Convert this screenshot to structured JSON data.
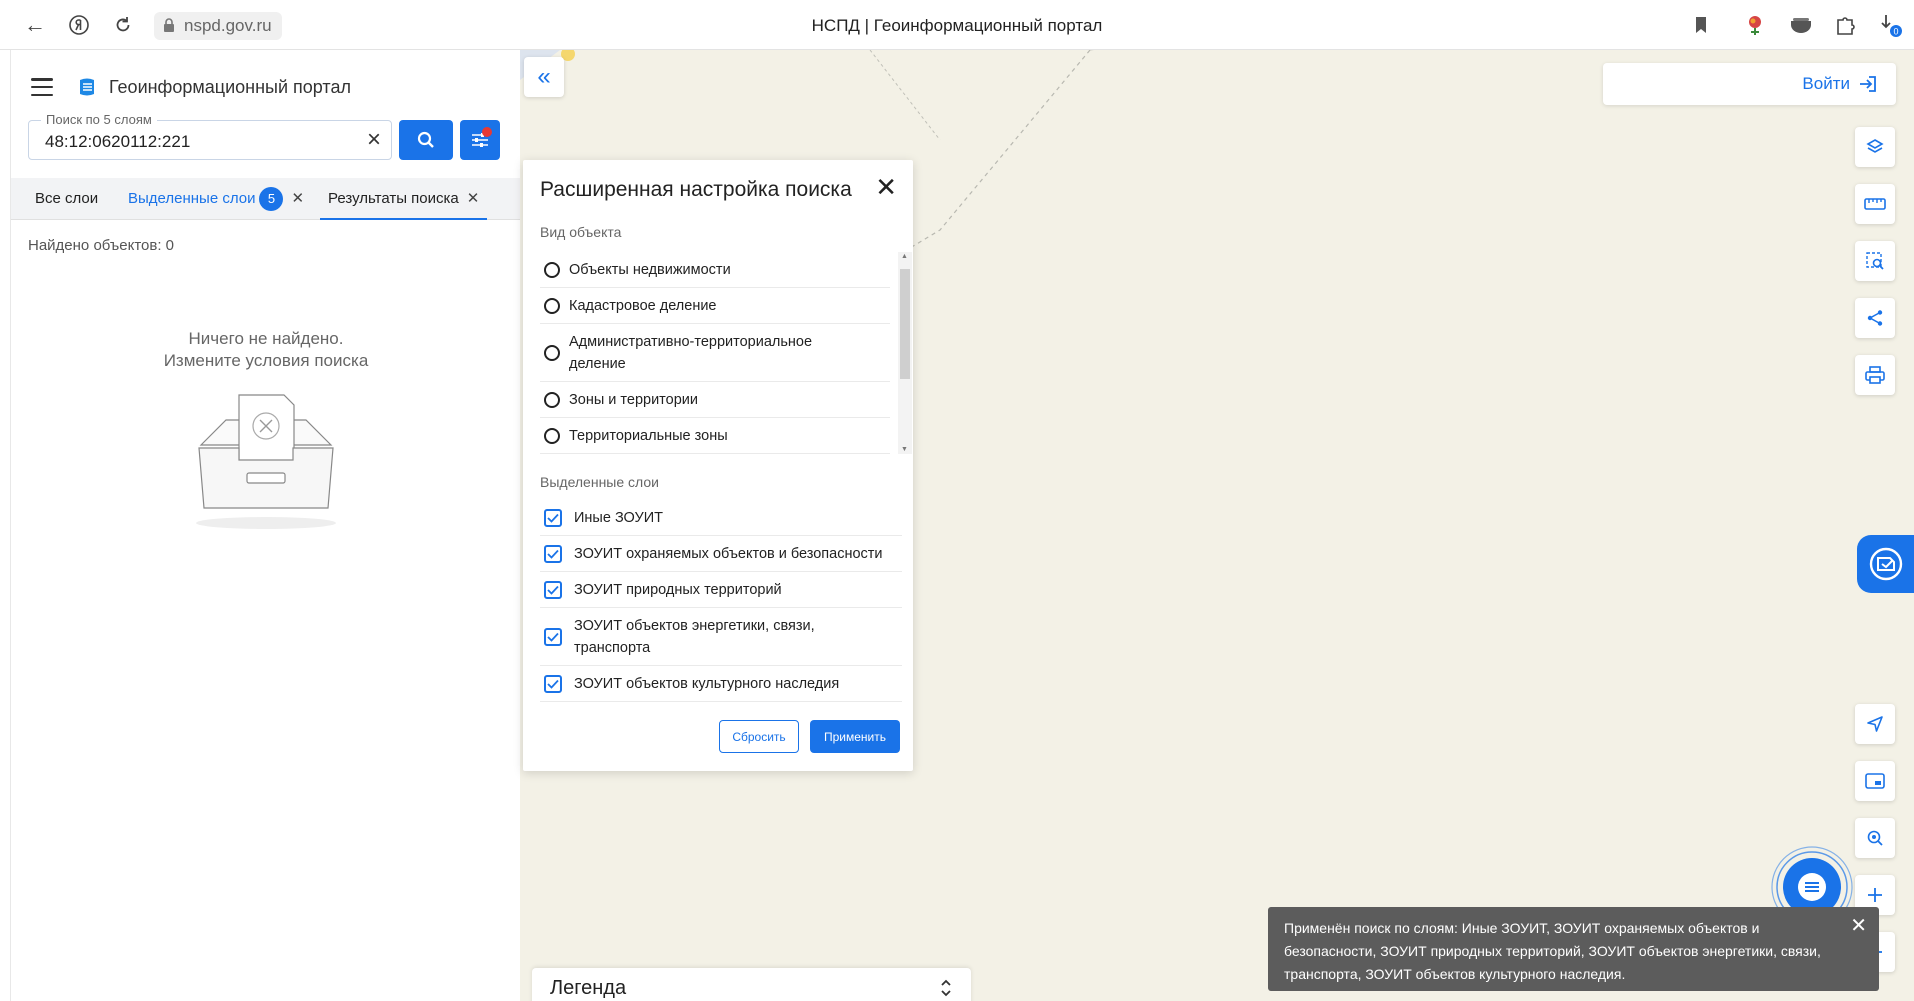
{
  "browser": {
    "url": "nspd.gov.ru",
    "page_title": "НСПД | Геоинформационный портал",
    "extension_badge": "0"
  },
  "header": {
    "title": "Геоинформационный портал"
  },
  "search": {
    "label": "Поиск по 5 слоям",
    "value": "48:12:0620112:221"
  },
  "tabs": [
    {
      "label": "Все слои"
    },
    {
      "label": "Выделенные слои",
      "badge": "5"
    },
    {
      "label": "Результаты поиска"
    }
  ],
  "results": {
    "found": "Найдено объектов: 0",
    "empty_line1": "Ничего не найдено.",
    "empty_line2": "Измените условия поиска"
  },
  "map": {
    "login_label": "Войти",
    "legend_label": "Легенда",
    "toast": "Применён поиск по слоям: Иные ЗОУИТ, ЗОУИТ охраняемых объектов и безопасности, ЗОУИТ природных территорий, ЗОУИТ объектов энергетики, связи, транспорта, ЗОУИТ объектов культурного наследия.",
    "tools": [
      "layers-icon",
      "ruler-icon",
      "select-area-icon",
      "share-icon",
      "print-icon",
      "locate-icon",
      "minimap-icon",
      "geo-search-icon",
      "zoom-in-icon",
      "zoom-out-icon"
    ]
  },
  "dialog": {
    "title": "Расширенная настройка поиска",
    "object_type_label": "Вид объекта",
    "object_types": [
      "Объекты недвижимости",
      "Кадастровое деление",
      "Административно-территориальное деление",
      "Зоны и территории",
      "Территориальные зоны"
    ],
    "layers_label": "Выделенные слои",
    "layers": [
      "Иные ЗОУИТ",
      "ЗОУИТ охраняемых объектов и безопасности",
      "ЗОУИТ природных территорий",
      "ЗОУИТ объектов энергетики, связи, транспорта",
      "ЗОУИТ объектов культурного наследия"
    ],
    "reset_label": "Сбросить",
    "apply_label": "Применить"
  },
  "colors": {
    "accent": "#1a73e8",
    "map_bg": "#f3f1e6",
    "toast_bg": "#5c5c5c"
  }
}
